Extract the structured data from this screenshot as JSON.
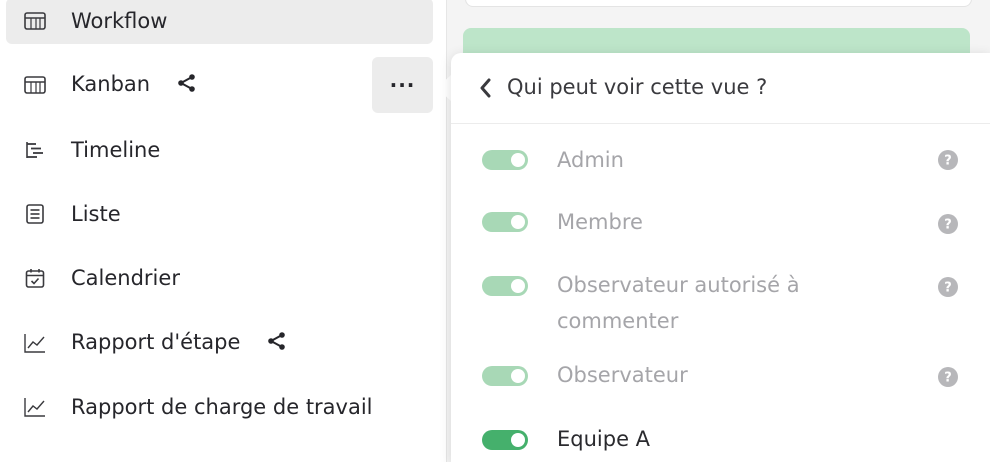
{
  "sidebar": {
    "items": [
      {
        "label": "Workflow",
        "icon": "table-icon",
        "active": true,
        "shared": false
      },
      {
        "label": "Kanban",
        "icon": "table-icon",
        "active": false,
        "shared": true
      },
      {
        "label": "Timeline",
        "icon": "timeline-icon",
        "active": false,
        "shared": false
      },
      {
        "label": "Liste",
        "icon": "list-icon",
        "active": false,
        "shared": false
      },
      {
        "label": "Calendrier",
        "icon": "calendar-icon",
        "active": false,
        "shared": false
      },
      {
        "label": "Rapport d'étape",
        "icon": "chart-line-icon",
        "active": false,
        "shared": true
      },
      {
        "label": "Rapport de charge de travail",
        "icon": "chart-line-icon",
        "active": false,
        "shared": false
      }
    ],
    "more_label": "···"
  },
  "popover": {
    "title": "Qui peut voir cette vue ?",
    "options": [
      {
        "label": "Admin",
        "enabled": true,
        "locked": true,
        "help": true
      },
      {
        "label": "Membre",
        "enabled": true,
        "locked": true,
        "help": true
      },
      {
        "label": "Observateur autorisé à commenter",
        "enabled": true,
        "locked": true,
        "help": true
      },
      {
        "label": "Observateur",
        "enabled": true,
        "locked": true,
        "help": true
      },
      {
        "label": "Equipe A",
        "enabled": true,
        "locked": false,
        "help": false
      }
    ]
  },
  "colors": {
    "toggle_locked": "#a8d8b6",
    "toggle_active": "#45b06c",
    "active_row_bg": "#ececec",
    "green_card": "#bde5c9"
  }
}
